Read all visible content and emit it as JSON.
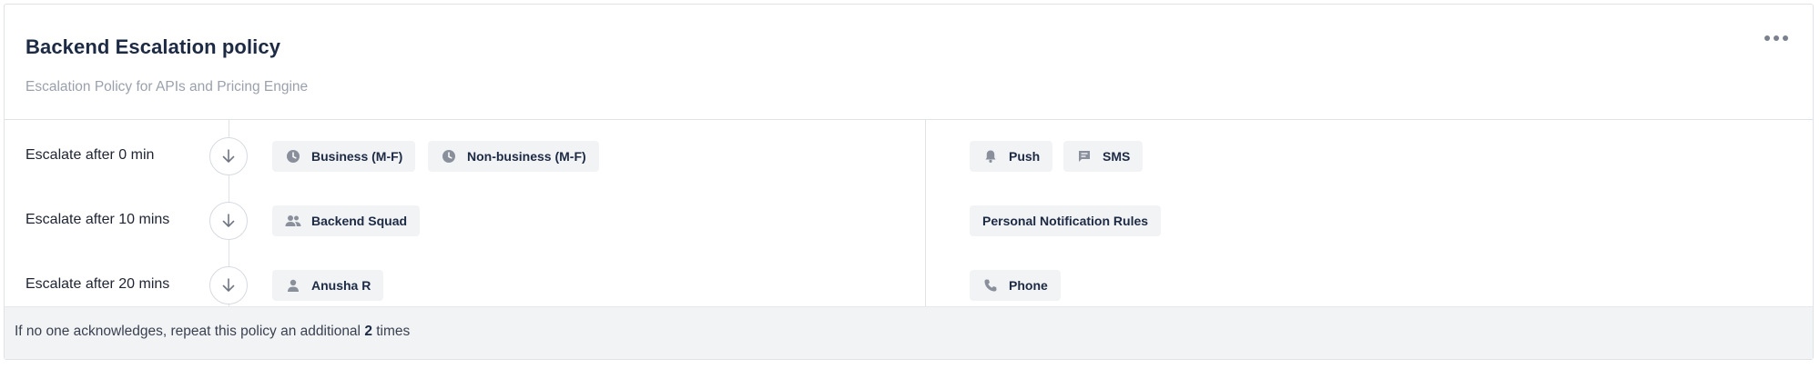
{
  "policy": {
    "title": "Backend Escalation policy",
    "subtitle": "Escalation Policy for APIs and Pricing Engine",
    "more_menu_icon": "more-horizontal-icon"
  },
  "steps": [
    {
      "label": "Escalate after 0 min",
      "targets": [
        {
          "icon": "clock-icon",
          "label": "Business (M-F)"
        },
        {
          "icon": "clock-icon",
          "label": "Non-business (M-F)"
        }
      ],
      "notifications": [
        {
          "icon": "bell-icon",
          "label": "Push"
        },
        {
          "icon": "chat-icon",
          "label": "SMS"
        }
      ]
    },
    {
      "label": "Escalate after 10 mins",
      "targets": [
        {
          "icon": "users-icon",
          "label": "Backend Squad"
        }
      ],
      "notifications": [
        {
          "icon": "",
          "label": "Personal Notification Rules"
        }
      ]
    },
    {
      "label": "Escalate after 20 mins",
      "targets": [
        {
          "icon": "user-icon",
          "label": "Anusha R"
        }
      ],
      "notifications": [
        {
          "icon": "phone-icon",
          "label": "Phone"
        }
      ]
    }
  ],
  "footer": {
    "text_before": "If no one acknowledges, repeat this policy an additional ",
    "repeat_count": "2",
    "text_after": " times"
  },
  "colors": {
    "icon_gray": "#8a909b",
    "chip_bg": "#f2f3f5",
    "border": "#dfe2e7",
    "title": "#1d2a44"
  }
}
